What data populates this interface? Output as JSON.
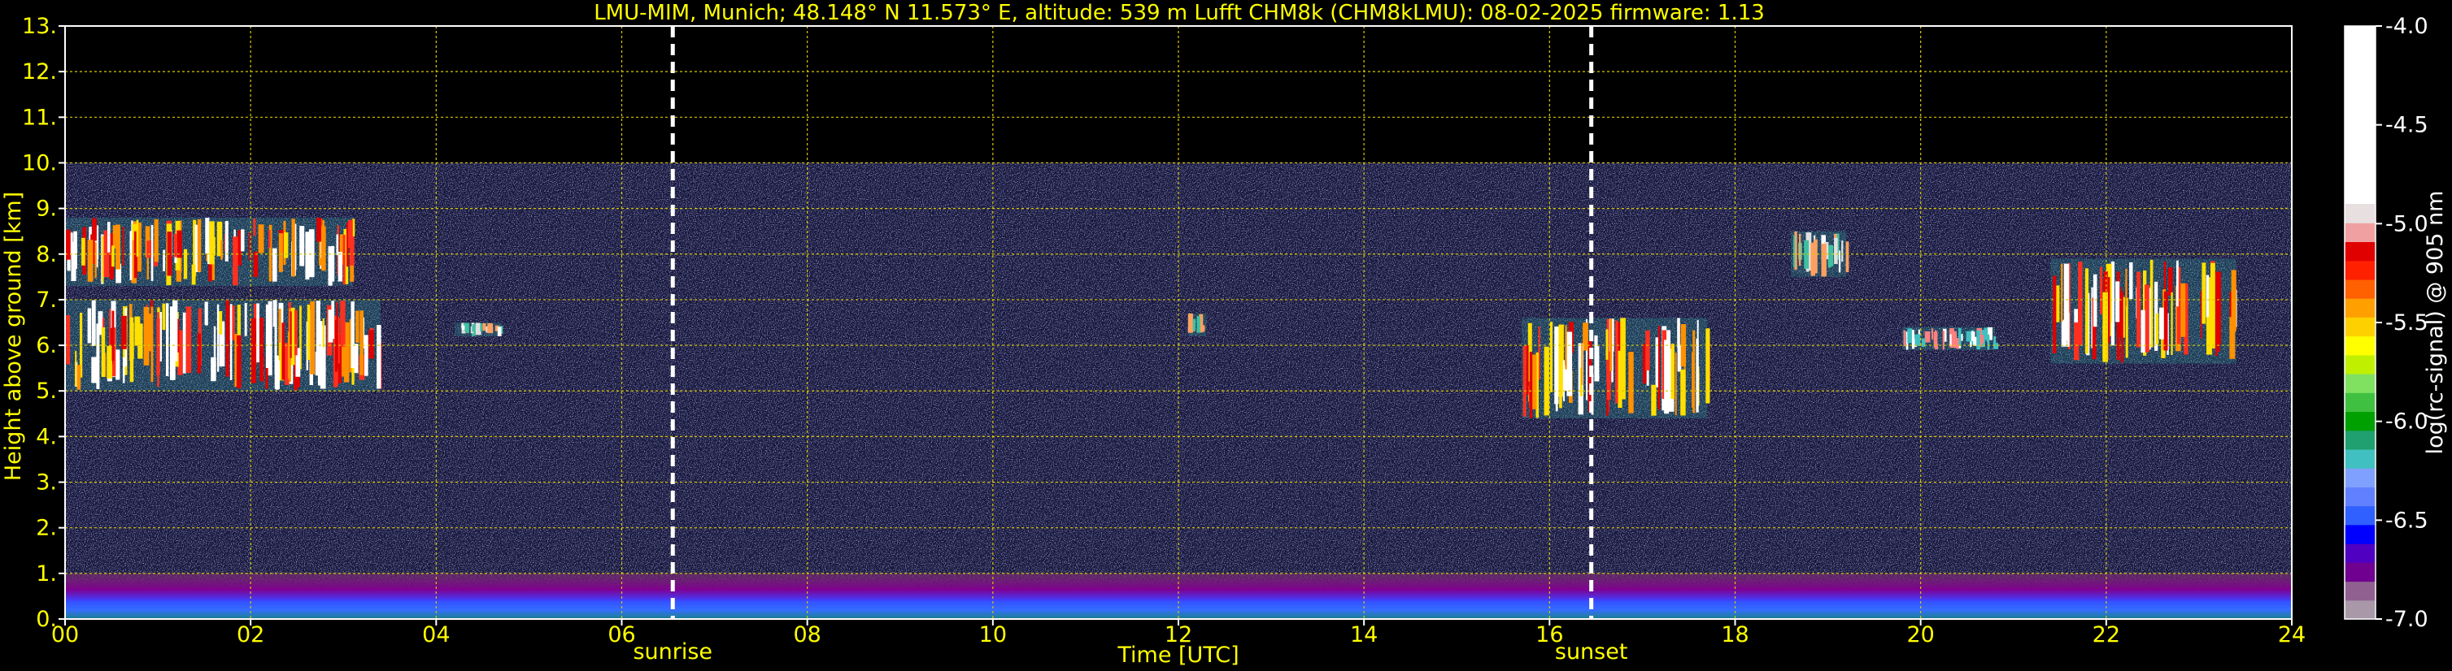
{
  "chart_data": {
    "type": "heatmap",
    "title": "LMU-MIM, Munich; 48.148° N 11.573° E, altitude: 539 m    Lufft CHM8k (CHM8kLMU): 08-02-2025    firmware: 1.13",
    "xlabel": "Time [UTC]",
    "ylabel": "Height above ground [km]",
    "xlim": [
      0,
      24
    ],
    "ylim": [
      0,
      13
    ],
    "x_ticks": [
      "00",
      "02",
      "04",
      "06",
      "08",
      "10",
      "12",
      "14",
      "16",
      "18",
      "20",
      "22",
      "24"
    ],
    "y_ticks": [
      "0.",
      "1.",
      "2.",
      "3.",
      "4.",
      "5.",
      "6.",
      "7.",
      "8.",
      "9.",
      "10.",
      "11.",
      "12.",
      "13."
    ],
    "grid": true,
    "data_ceiling_km": 10,
    "markers": [
      {
        "name": "sunrise",
        "x": 6.55
      },
      {
        "name": "sunset",
        "x": 16.45
      }
    ],
    "colorbar": {
      "label": "log(rc-signal) @ 905 nm",
      "range": [
        -7.0,
        -4.0
      ],
      "ticks": [
        "-4.0",
        "-4.5",
        "-5.0",
        "-5.5",
        "-6.0",
        "-6.5",
        "-7.0"
      ],
      "colors": [
        "#a898a8",
        "#906090",
        "#700090",
        "#5000c0",
        "#0000ff",
        "#3060ff",
        "#6080ff",
        "#80a0ff",
        "#40c0c0",
        "#20a070",
        "#00a000",
        "#40c040",
        "#80e060",
        "#c0f000",
        "#ffff00",
        "#ffd000",
        "#ffa000",
        "#ff6000",
        "#ff2000",
        "#e00000",
        "#f0a0a0",
        "#e8e0e0",
        "#ffffff"
      ]
    },
    "cloud_layers": [
      {
        "t_start": 0.0,
        "t_end": 3.1,
        "h_low": 7.3,
        "h_high": 8.8,
        "intensity": "high"
      },
      {
        "t_start": 0.0,
        "t_end": 3.4,
        "h_low": 5.0,
        "h_high": 7.0,
        "intensity": "high"
      },
      {
        "t_start": 4.2,
        "t_end": 4.7,
        "h_low": 6.2,
        "h_high": 6.5,
        "intensity": "medium"
      },
      {
        "t_start": 12.1,
        "t_end": 12.3,
        "h_low": 6.2,
        "h_high": 6.7,
        "intensity": "medium"
      },
      {
        "t_start": 15.7,
        "t_end": 17.7,
        "h_low": 4.4,
        "h_high": 6.6,
        "intensity": "high"
      },
      {
        "t_start": 18.6,
        "t_end": 19.2,
        "h_low": 7.5,
        "h_high": 8.5,
        "intensity": "medium"
      },
      {
        "t_start": 19.8,
        "t_end": 20.8,
        "h_low": 5.9,
        "h_high": 6.4,
        "intensity": "low"
      },
      {
        "t_start": 21.4,
        "t_end": 23.4,
        "h_low": 5.6,
        "h_high": 7.9,
        "intensity": "high"
      }
    ],
    "boundary_layer": {
      "aerosol_top_km": 1.0,
      "dense_top_km": 0.4
    }
  }
}
